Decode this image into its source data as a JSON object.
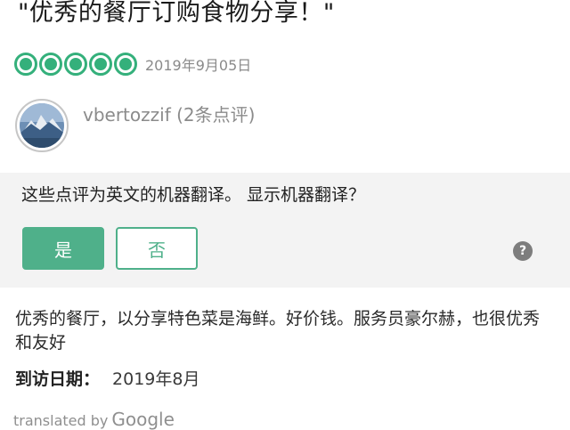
{
  "review": {
    "title": "\"优秀的餐厅订购食物分享！\"",
    "rating": 5,
    "date": "2019年9月05日",
    "user": "vbertozzif (2条点评)",
    "text": "优秀的餐厅，以分享特色菜是海鲜。好价钱。服务员豪尔赫，也很优秀和友好",
    "visit_label": "到访日期：",
    "visit_value": "2019年8月"
  },
  "translation": {
    "question": "这些点评为英文的机器翻译。 显示机器翻译？",
    "yes_label": "是",
    "no_label": "否",
    "help_icon": "?",
    "translated_by": "translated by",
    "provider": "Google"
  },
  "colors": {
    "rating_green": "#34b07b",
    "button_green": "#4fb08a",
    "panel_bg": "#f3f3f3"
  },
  "icons": [
    "rating-bubble-icon",
    "question-mark-icon"
  ]
}
